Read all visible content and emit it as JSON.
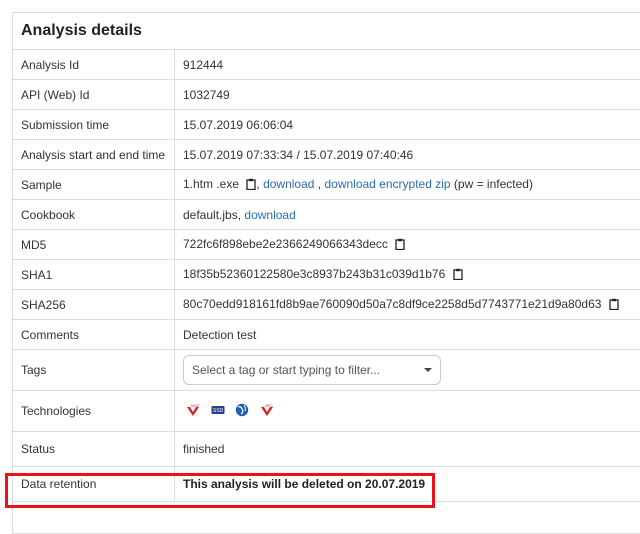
{
  "title": "Analysis details",
  "rows": {
    "analysis_id": {
      "label": "Analysis Id",
      "value": "912444"
    },
    "api_id": {
      "label": "API (Web) Id",
      "value": "1032749"
    },
    "submission_time": {
      "label": "Submission time",
      "value": "15.07.2019 06:06:04"
    },
    "start_end": {
      "label": "Analysis start and end time",
      "value": "15.07.2019 07:33:34 / 15.07.2019 07:40:46"
    },
    "sample": {
      "label": "Sample",
      "filename": "1.htm .exe",
      "download_link": "download",
      "sep": ",",
      "download_encrypted_link": "download encrypted zip",
      "pw_note": "(pw = infected)"
    },
    "cookbook": {
      "label": "Cookbook",
      "filename": "default.jbs,",
      "download_link": "download"
    },
    "md5": {
      "label": "MD5",
      "value": "722fc6f898ebe2e2366249066343decc"
    },
    "sha1": {
      "label": "SHA1",
      "value": "18f35b52360122580e3c8937b243b31c039d1b76"
    },
    "sha256": {
      "label": "SHA256",
      "value": "80c70edd918161fd8b9ae760090d50a7c8df9ce2258d5d7743771e21d9a80d63"
    },
    "comments": {
      "label": "Comments",
      "value": "Detection test"
    },
    "tags": {
      "label": "Tags",
      "placeholder": "Select a tag or start typing to filter..."
    },
    "technologies": {
      "label": "Technologies",
      "icons": [
        "ngf-logo-icon",
        "ssd-chip-icon",
        "globe-icon",
        "afc-logo-icon"
      ]
    },
    "status": {
      "label": "Status",
      "value": "finished"
    },
    "data_retention": {
      "label": "Data retention",
      "value": "This analysis will be deleted on 20.07.2019"
    }
  },
  "colors": {
    "link": "#2a6db5",
    "highlight": "#e8141c",
    "border": "#dddddd"
  }
}
